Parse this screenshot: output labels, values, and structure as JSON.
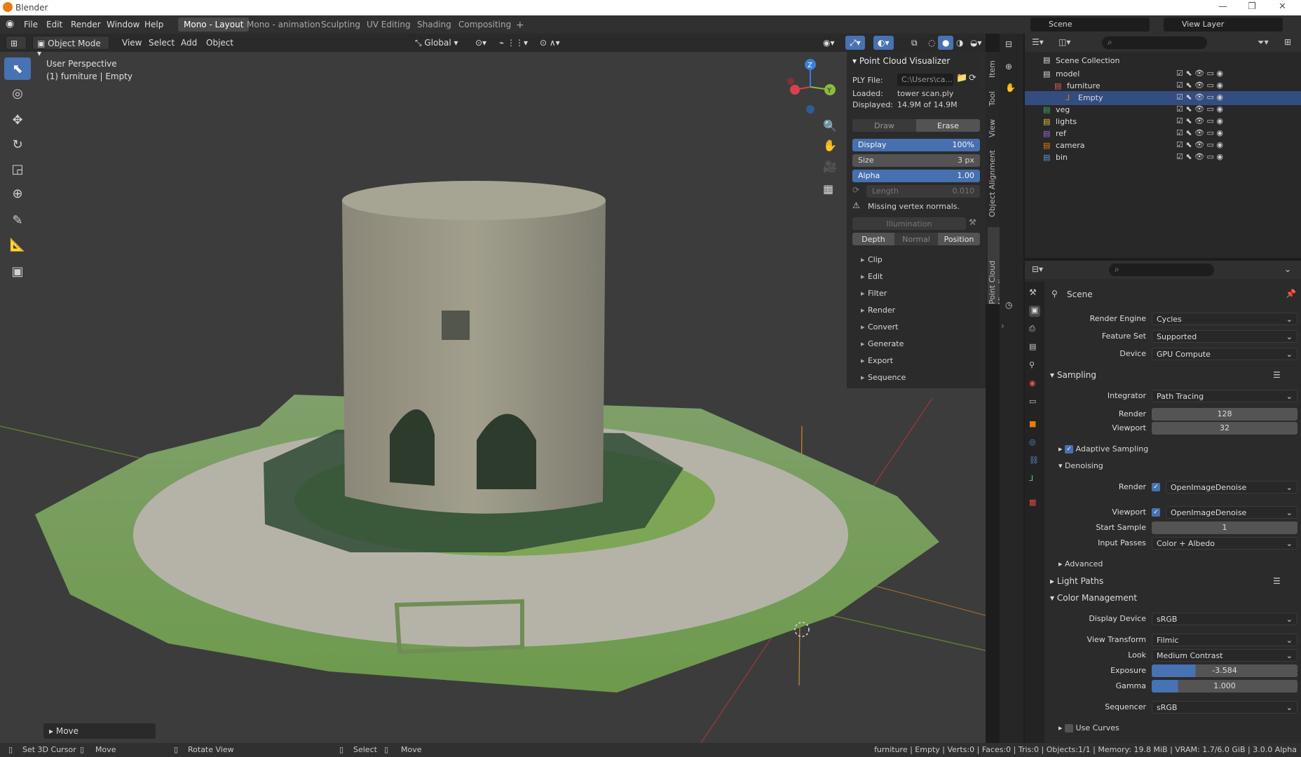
{
  "app": {
    "title": "Blender"
  },
  "menu": [
    "File",
    "Edit",
    "Render",
    "Window",
    "Help"
  ],
  "workspaces": [
    {
      "label": "Mono - Layout",
      "active": true
    },
    {
      "label": "Mono - animation"
    },
    {
      "label": "Sculpting"
    },
    {
      "label": "UV Editing"
    },
    {
      "label": "Shading"
    },
    {
      "label": "Compositing"
    }
  ],
  "top_right": {
    "scene": "Scene",
    "view_layer": "View Layer"
  },
  "viewport_header": {
    "mode": "Object Mode",
    "items": [
      "View",
      "Select",
      "Add",
      "Object"
    ],
    "orientation": "Global"
  },
  "viewport": {
    "perspective": "User Perspective",
    "active": "(1) furniture | Empty",
    "last_op": "Move"
  },
  "pcv": {
    "title": "Point Cloud Visualizer",
    "ply_label": "PLY File:",
    "ply_path": "C:\\Users\\ca...",
    "loaded_label": "Loaded:",
    "loaded_value": "tower scan.ply",
    "displayed_label": "Displayed:",
    "displayed_value": "14.9M of 14.9M",
    "draw": "Draw",
    "erase": "Erase",
    "display_label": "Display",
    "display_value": "100%",
    "size_label": "Size",
    "size_value": "3 px",
    "alpha_label": "Alpha",
    "alpha_value": "1.00",
    "length_label": "Length",
    "length_value": "0.010",
    "warning": "Missing vertex normals.",
    "illumination": "Illumination",
    "shading_modes": [
      "Depth",
      "Normal",
      "Position"
    ],
    "subpanels": [
      "Clip",
      "Edit",
      "Filter",
      "Render",
      "Convert",
      "Generate",
      "Export",
      "Sequence"
    ]
  },
  "side_tabs": [
    "Item",
    "Tool",
    "View",
    "Object Alignment",
    "Point Cloud Visualizer"
  ],
  "outliner": {
    "root": "Scene Collection",
    "rows": [
      {
        "label": "model",
        "indent": 1
      },
      {
        "label": "furniture",
        "indent": 2
      },
      {
        "label": "Empty",
        "indent": 3,
        "selected": true
      },
      {
        "label": "veg",
        "indent": 1
      },
      {
        "label": "lights",
        "indent": 1
      },
      {
        "label": "ref",
        "indent": 1
      },
      {
        "label": "camera",
        "indent": 1
      },
      {
        "label": "bin",
        "indent": 1
      }
    ]
  },
  "properties": {
    "context": "Scene",
    "render_engine_label": "Render Engine",
    "render_engine": "Cycles",
    "feature_set_label": "Feature Set",
    "feature_set": "Supported",
    "device_label": "Device",
    "device": "GPU Compute",
    "sampling": "Sampling",
    "integrator_label": "Integrator",
    "integrator": "Path Tracing",
    "render_label": "Render",
    "render_samples": "128",
    "viewport_label": "Viewport",
    "viewport_samples": "32",
    "adaptive": "Adaptive Sampling",
    "denoising": "Denoising",
    "den_render_label": "Render",
    "den_render": "OpenImageDenoise",
    "den_viewport_label": "Viewport",
    "den_viewport": "OpenImageDenoise",
    "start_sample_label": "Start Sample",
    "start_sample": "1",
    "input_passes_label": "Input Passes",
    "input_passes": "Color + Albedo",
    "advanced": "Advanced",
    "light_paths": "Light Paths",
    "color_management": "Color Management",
    "display_device_label": "Display Device",
    "display_device": "sRGB",
    "view_transform_label": "View Transform",
    "view_transform": "Filmic",
    "look_label": "Look",
    "look": "Medium Contrast",
    "exposure_label": "Exposure",
    "exposure": "-3.584",
    "gamma_label": "Gamma",
    "gamma": "1.000",
    "sequencer_label": "Sequencer",
    "sequencer": "sRGB",
    "use_curves": "Use Curves"
  },
  "status": {
    "items": [
      "Set 3D Cursor",
      "Move",
      "Rotate View",
      "Select",
      "Move"
    ],
    "info": "furniture | Empty | Verts:0 | Faces:0 | Tris:0 | Objects:1/1 | Memory: 19.8 MiB | VRAM: 1.7/6.0 GiB | 3.0.0 Alpha"
  },
  "colors": {
    "accent": "#4772b3",
    "selection": "#334d80",
    "brand": "#e87d0d"
  }
}
